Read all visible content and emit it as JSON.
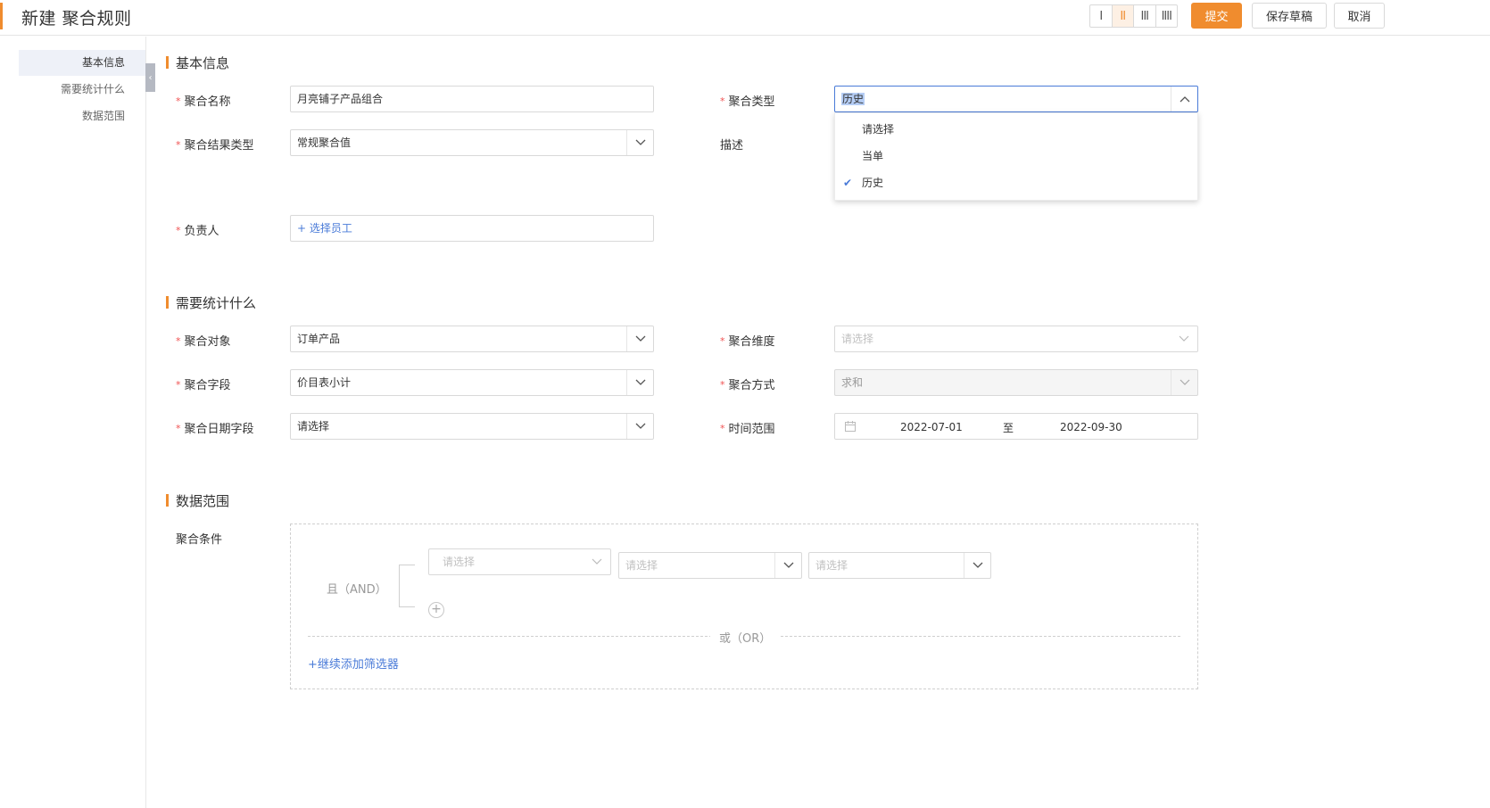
{
  "header": {
    "title": "新建 聚合规则",
    "layout_options": [
      "I",
      "II",
      "III",
      "IIII"
    ],
    "active_layout": "II",
    "submit_label": "提交",
    "draft_label": "保存草稿",
    "cancel_label": "取消"
  },
  "sidenav": {
    "items": [
      {
        "label": "基本信息",
        "active": true
      },
      {
        "label": "需要统计什么",
        "active": false
      },
      {
        "label": "数据范围",
        "active": false
      }
    ]
  },
  "basic": {
    "section_title": "基本信息",
    "name_label": "聚合名称",
    "name_value": "月亮铺子产品组合",
    "type_label": "聚合类型",
    "type_value": "历史",
    "result_type_label": "聚合结果类型",
    "result_type_value": "常规聚合值",
    "desc_label": "描述",
    "owner_label": "负责人",
    "owner_action": "+ 选择员工"
  },
  "type_dropdown": {
    "options": [
      "请选择",
      "当单",
      "历史"
    ],
    "selected": "历史"
  },
  "stats": {
    "section_title": "需要统计什么",
    "object_label": "聚合对象",
    "object_value": "订单产品",
    "dimension_label": "聚合维度",
    "dimension_placeholder": "请选择",
    "field_label": "聚合字段",
    "field_value": "价目表小计",
    "method_label": "聚合方式",
    "method_value": "求和",
    "date_field_label": "聚合日期字段",
    "date_field_value": "请选择",
    "time_range_label": "时间范围",
    "date_start": "2022-07-01",
    "date_to": "至",
    "date_end": "2022-09-30"
  },
  "scope": {
    "section_title": "数据范围",
    "condition_label": "聚合条件",
    "and_label": "且（AND）",
    "filter1_placeholder": "请选择",
    "filter2_placeholder": "请选择",
    "filter3_placeholder": "请选择",
    "add_symbol": "+",
    "or_label": "或（OR）",
    "add_filter_label": "+继续添加筛选器"
  }
}
